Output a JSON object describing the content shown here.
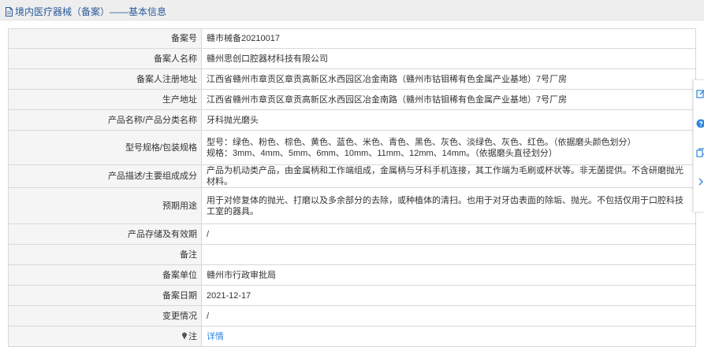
{
  "header": {
    "title": "境内医疗器械（备案）——基本信息",
    "icon": "document-icon"
  },
  "rows": [
    {
      "label": "备案号",
      "value": "赣市械备20210017"
    },
    {
      "label": "备案人名称",
      "value": "赣州思创口腔器材科技有限公司"
    },
    {
      "label": "备案人注册地址",
      "value": "江西省赣州市章贡区章贡高新区水西园区冶金南路（赣州市钴钼稀有色金属产业基地）7号厂房"
    },
    {
      "label": "生产地址",
      "value": "江西省赣州市章贡区章贡高新区水西园区冶金南路（赣州市钴钼稀有色金属产业基地）7号厂房"
    },
    {
      "label": "产品名称/产品分类名称",
      "value": "牙科抛光磨头"
    },
    {
      "label": "型号规格/包装规格",
      "value_line1": "型号：绿色、粉色、棕色、黄色、蓝色、米色、青色、黑色、灰色、淡绿色、灰色、红色。（依据磨头颜色划分）",
      "value_line2": "规格：3mm、4mm、5mm、6mm、10mm、11mm、12mm、14mm。（依据磨头直径划分）"
    },
    {
      "label": "产品描述/主要组成成分",
      "value": "产品为机动类产品，由金属柄和工作端组成，金属柄与牙科手机连接，其工作端为毛刷或杯状等。非无菌提供。不含研磨抛光材料。"
    },
    {
      "label": "预期用途",
      "value": "用于对修复体的抛光、打磨以及多余部分的去除，或种植体的清扫。也用于对牙齿表面的除垢、抛光。不包括仅用于口腔科技工室的器具。"
    },
    {
      "label": "产品存储及有效期",
      "value": "/"
    },
    {
      "label": "备注",
      "value": ""
    },
    {
      "label": "备案单位",
      "value": "赣州市行政审批局"
    },
    {
      "label": "备案日期",
      "value": "2021-12-17"
    },
    {
      "label": "变更情况",
      "value": "/"
    },
    {
      "label": "注",
      "value": "详情",
      "icon": "pin-icon"
    }
  ],
  "side_toolbar": {
    "icons": [
      "edit-icon",
      "help-icon",
      "copy-icon",
      "chevron-right-icon"
    ]
  },
  "colors": {
    "header_bg": "#eeeeee",
    "header_text": "#2b5b9a",
    "label_bg": "#f5f5f5",
    "border": "#d8d8d8",
    "link": "#2e86de",
    "side_icon": "#2e86de"
  }
}
